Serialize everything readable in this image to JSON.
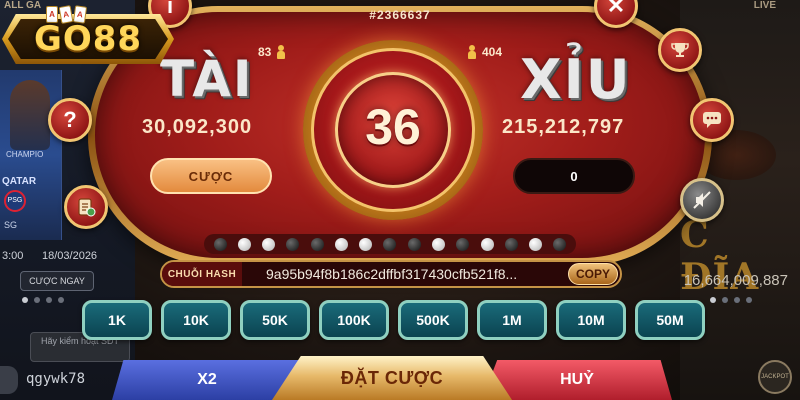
{
  "background": {
    "left_top_text": "ALL GA",
    "right_top_text": "LIVE",
    "left_schedule_time": "3:00",
    "left_schedule_date": "18/03/2026",
    "left_bet_button": "CƯỢC NGAY",
    "left_phone_placeholder": "Hãy kiểm hoạt SĐT",
    "left_username": "qgywk78",
    "left_card_shirt": "QATAR",
    "left_card_badge": "PSG",
    "left_card_caption": "SG",
    "left_card_champ": "CHAMPIO",
    "right_game_title": "C ĐĨA",
    "right_jackpot": "16,664,009,887",
    "right_badge": "JACKPOT"
  },
  "logo": {
    "text": "GO88",
    "card_marks": [
      "A",
      "A",
      "A"
    ]
  },
  "game": {
    "session_id": "#2366637",
    "tai": {
      "label": "TÀI",
      "players": "83",
      "total_bet": "30,092,300",
      "bet_button": "CƯỢC"
    },
    "xiu": {
      "label": "XỈU",
      "players": "404",
      "total_bet": "215,212,797",
      "bet_value": "0"
    },
    "countdown": "36",
    "history": [
      "black",
      "white",
      "white",
      "black",
      "black",
      "white",
      "white",
      "black",
      "black",
      "white",
      "black",
      "white",
      "black",
      "white",
      "black"
    ],
    "hash": {
      "label": "CHUỖI HASH",
      "value": "9a95b94f8b186c2dffbf317430cfb521f8...",
      "copy_label": "COPY"
    }
  },
  "side_buttons": {
    "help": "?",
    "close": "✕",
    "info": "i"
  },
  "chips": [
    "1K",
    "10K",
    "50K",
    "100K",
    "500K",
    "1M",
    "10M",
    "50M"
  ],
  "actions": {
    "double": "X2",
    "place_bet": "ĐẶT CƯỢC",
    "cancel": "HUỶ"
  }
}
